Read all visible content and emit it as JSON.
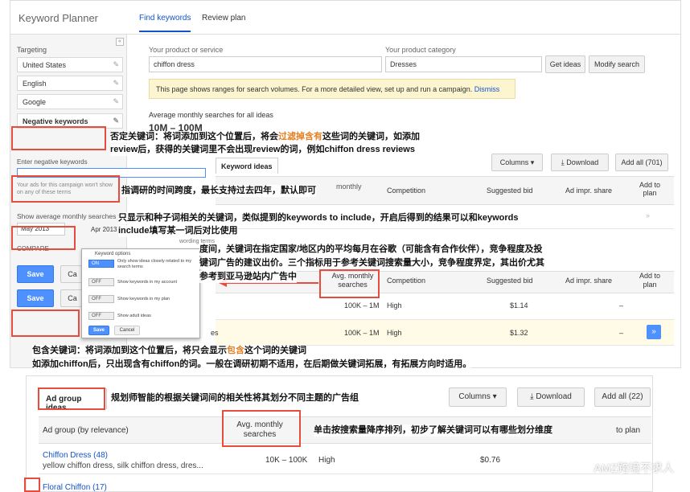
{
  "header": {
    "title": "Keyword Planner",
    "tabs": [
      "Find keywords",
      "Review plan"
    ]
  },
  "sidebar": {
    "targeting_label": "Targeting",
    "targets": [
      "United States",
      "English",
      "Google"
    ],
    "negative_keywords": "Negative keywords",
    "enter_negative_placeholder": "Enter negative keywords",
    "ads_note": "Your ads for this campaign won't show on any of these terms",
    "show_avg_label": "Show average monthly searches for",
    "date_from": "May 2013",
    "date_to": "Apr 2013",
    "compare": "COMPARE",
    "save": "Save",
    "cancel": "Ca",
    "save2": "Save",
    "cancel2": "Ca"
  },
  "main": {
    "product_label": "Your product or service",
    "product_value": "chiffon dress",
    "category_label": "Your product category",
    "category_value": "Dresses",
    "get_ideas": "Get ideas",
    "modify_search": "Modify search",
    "notice": "This page shows ranges for search volumes. For a more detailed view, set up and run a campaign.",
    "dismiss": "Dismiss",
    "avg_label": "Average monthly searches for all ideas",
    "avg_value": "10M – 100M",
    "tab_keyword_ideas": "Keyword ideas",
    "columns": "Columns",
    "download": "Download",
    "add_all": "Add all (701)",
    "col_monthly": "monthly",
    "col_competition": "Competition",
    "col_bid": "Suggested bid",
    "col_share": "Ad impr. share",
    "col_add": "Add to plan",
    "wording_terms": "wording terms",
    "col2_avg": "Avg. monthly searches",
    "col2_comp": "Competition",
    "col2_bid": "Suggested bid",
    "col2_share": "Ad impr. share",
    "col2_add": "Add to plan",
    "rows": [
      {
        "kw": "",
        "vol": "100K – 1M",
        "comp": "High",
        "bid": "$1.14",
        "share": "–"
      },
      {
        "kw": "es",
        "vol": "100K – 1M",
        "comp": "High",
        "bid": "$1.32",
        "share": "–"
      }
    ]
  },
  "popup": {
    "title": "Keyword options",
    "on": "ON",
    "off": "OFF",
    "opt1": "Only show ideas closely related to my search terms",
    "opt2": "Show keywords in my account",
    "opt3": "Show keywords in my plan",
    "opt4": "Show adult ideas",
    "save": "Save",
    "cancel": "Cancel"
  },
  "panel2": {
    "tab_ad_group": "Ad group ideas",
    "columns": "Columns",
    "download": "Download",
    "add_all": "Add all (22)",
    "col_group": "Ad group (by relevance)",
    "col_avg": "Avg. monthly searches",
    "col_add": "to plan",
    "row1_name": "Chiffon Dress (48)",
    "row1_kws": "yellow chiffon dress, silk chiffon dress, dres...",
    "row1_vol": "10K – 100K",
    "row1_comp": "High",
    "row1_bid": "$0.76",
    "row2_name": "Floral Chiffon (17)"
  },
  "annotations": {
    "a1_pre": "否定关键词：将词添加到这个位置后，将会",
    "a1_hl": "过滤掉含有",
    "a1_post": "这些词的关键词，如添加",
    "a1_line2": "review后，获得的关键词里不会出现review的词，例如chiffon dress reviews",
    "a2": "指调研的时间跨度，最长支持过去四年，默认即可",
    "a3_l1": "只显示和种子词相关的关键词，类似提到的keywords to include，开启后得到的结果可以和keywords",
    "a3_l2": "include填写某一词后对比使用",
    "a4_l1": "度间，关键词在指定国家/地区内的平均每月在谷歌（可能含有合作伙伴），竞争程度及投",
    "a4_l2": "键词广告的建议出价。三个指标用于参考关键词搜索量大小，竞争程度界定，其出价尤其",
    "a4_l3": "参考到亚马逊站内广告中",
    "a5_pre": "包含关键词：将词添加到这个位置后，将只会显示",
    "a5_hl": "包含",
    "a5_post": "这个词的关键词",
    "a5_line2": "如添加chiffon后，只出现含有chiffon的词。一般在调研初期不适用，在后期做关键词拓展，有拓展方向时适用。",
    "a6": "规划师智能的根据关键词间的相关性将其划分不同主题的广告组",
    "a7": "单击按搜索量降序排列，初步了解关键词可以有哪些划分维度",
    "watermark": "AMZ跨境不求人"
  },
  "colors": {
    "accent": "#4d90fe",
    "annotation_box": "#e74c3c",
    "highlight": "#e67e22",
    "notice_bg": "#fdf5cf"
  }
}
